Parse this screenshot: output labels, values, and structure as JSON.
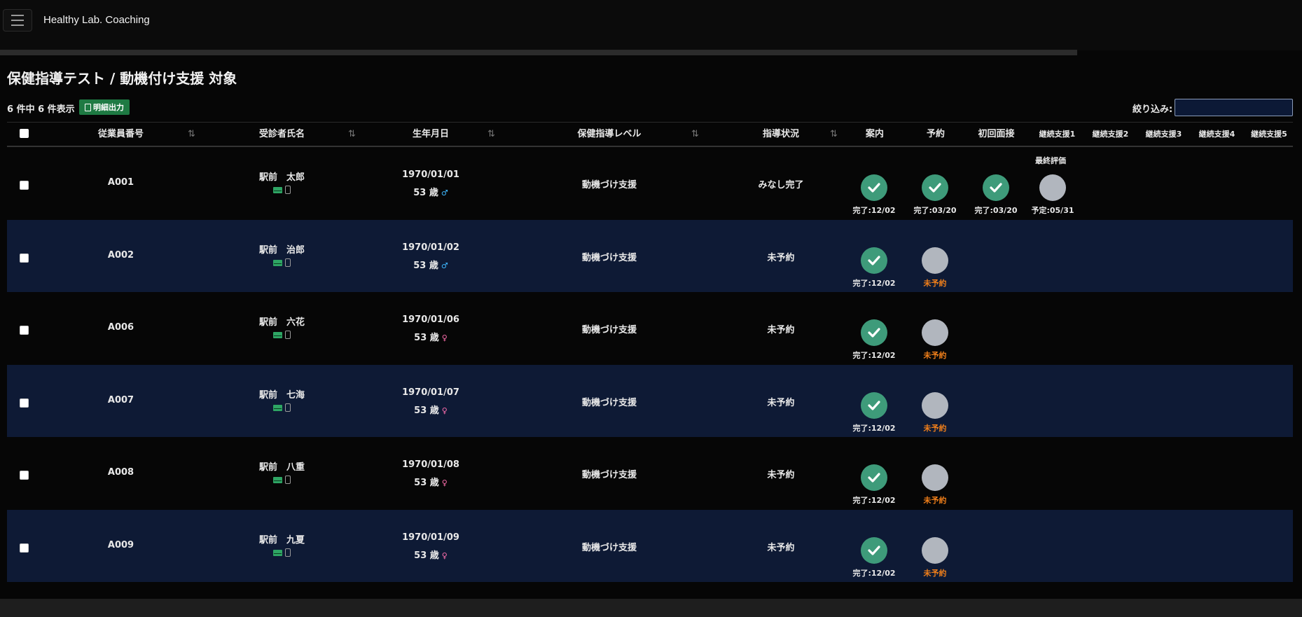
{
  "app": {
    "title": "Healthy Lab. Coaching",
    "menu_icon": "hamburger-icon"
  },
  "page": {
    "title": "保健指導テスト / 動機付け支援 対象",
    "count_text": "6 件中 6 件表示",
    "export_label": "明細出力",
    "filter_label": "絞り込み:",
    "filter_value": ""
  },
  "table": {
    "columns": [
      "従業員番号",
      "受診者氏名",
      "生年月日",
      "保健指導レベル",
      "指導状況",
      "案内",
      "予約",
      "初回面接",
      "継続支援1",
      "継続支援2",
      "継続支援3",
      "継続支援4",
      "継続支援5"
    ],
    "final_eval_label": "最終評価",
    "rows": [
      {
        "id": "A001",
        "name": "駅前　太郎",
        "dob": "1970/01/01",
        "age": "53 歳",
        "gender": "male",
        "level": "動機づけ支援",
        "status": "みなし完了",
        "steps": [
          {
            "state": "done",
            "label": "完了:12/02"
          },
          {
            "state": "done",
            "label": "完了:03/20"
          },
          {
            "state": "done",
            "label": "完了:03/20"
          },
          {
            "state": "pending",
            "label": "予定:05/31"
          }
        ]
      },
      {
        "id": "A002",
        "name": "駅前　治郎",
        "dob": "1970/01/02",
        "age": "53 歳",
        "gender": "male",
        "level": "動機づけ支援",
        "status": "未予約",
        "steps": [
          {
            "state": "done",
            "label": "完了:12/02"
          },
          {
            "state": "pending",
            "label": "未予約"
          }
        ]
      },
      {
        "id": "A006",
        "name": "駅前　六花",
        "dob": "1970/01/06",
        "age": "53 歳",
        "gender": "female",
        "level": "動機づけ支援",
        "status": "未予約",
        "steps": [
          {
            "state": "done",
            "label": "完了:12/02"
          },
          {
            "state": "pending",
            "label": "未予約"
          }
        ]
      },
      {
        "id": "A007",
        "name": "駅前　七海",
        "dob": "1970/01/07",
        "age": "53 歳",
        "gender": "female",
        "level": "動機づけ支援",
        "status": "未予約",
        "steps": [
          {
            "state": "done",
            "label": "完了:12/02"
          },
          {
            "state": "pending",
            "label": "未予約"
          }
        ]
      },
      {
        "id": "A008",
        "name": "駅前　八重",
        "dob": "1970/01/08",
        "age": "53 歳",
        "gender": "female",
        "level": "動機づけ支援",
        "status": "未予約",
        "steps": [
          {
            "state": "done",
            "label": "完了:12/02"
          },
          {
            "state": "pending",
            "label": "未予約"
          }
        ]
      },
      {
        "id": "A009",
        "name": "駅前　九夏",
        "dob": "1970/01/09",
        "age": "53 歳",
        "gender": "female",
        "level": "動機づけ支援",
        "status": "未予約",
        "steps": [
          {
            "state": "done",
            "label": "完了:12/02"
          },
          {
            "state": "pending",
            "label": "未予約"
          }
        ]
      }
    ]
  },
  "colors": {
    "done": "#3e9b7a",
    "pending": "#b1b6be",
    "unbooked_text": "#f07f1a",
    "row_alt": "#0e1a35",
    "export_button": "#1e7a43"
  }
}
